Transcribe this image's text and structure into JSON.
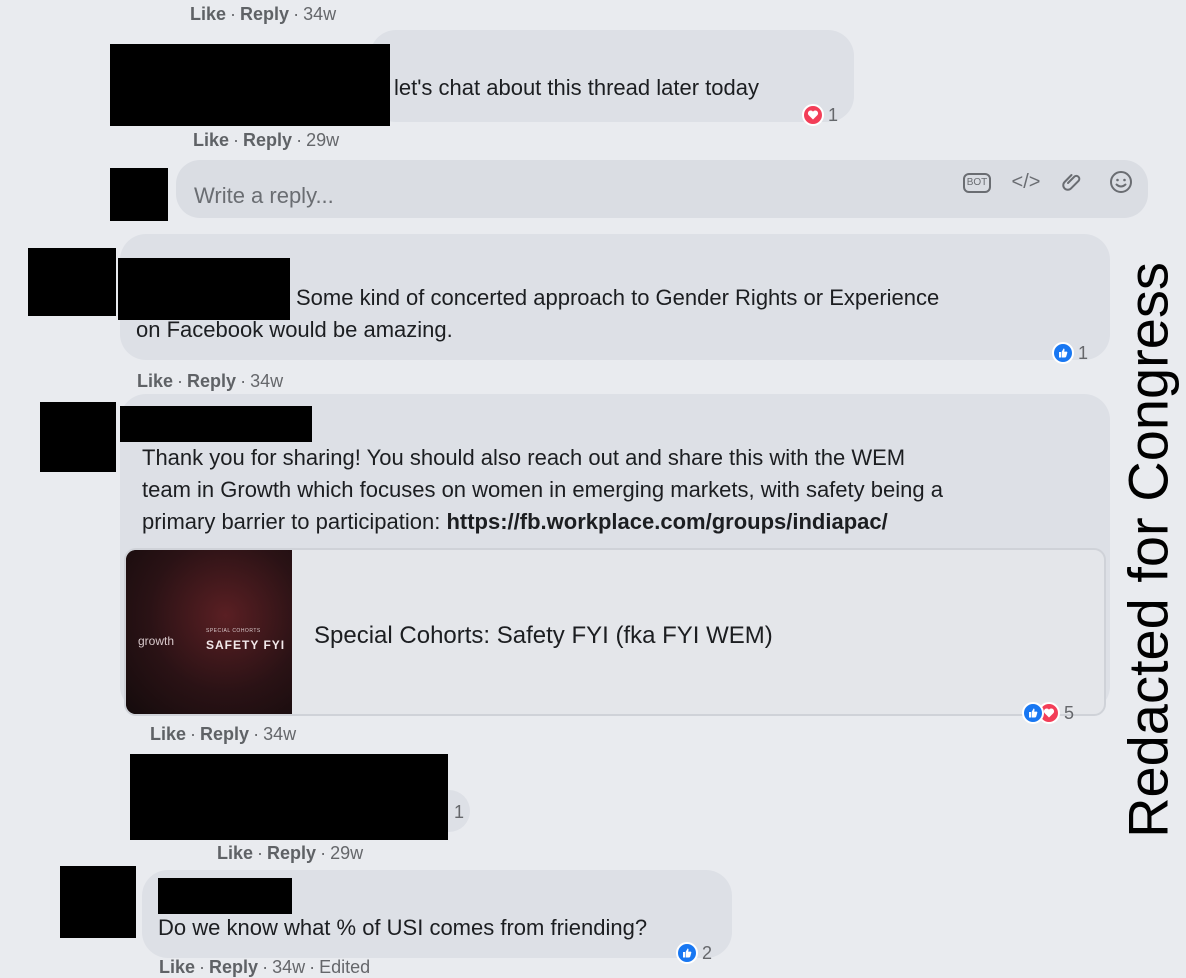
{
  "meta_like": "Like",
  "meta_reply": "Reply",
  "meta_sep": "·",
  "comments": [
    {
      "time": "34w"
    },
    {
      "text": "let's chat about this thread later today",
      "reaction_count": "1",
      "time": "29w"
    },
    {
      "text_line1": "Some kind of concerted approach to Gender Rights or Experience",
      "text_line2": "on Facebook would be amazing.",
      "reaction_count": "1",
      "time": "34w"
    },
    {
      "text_line1": "Thank you for sharing! You should also reach out and share this with the WEM",
      "text_line2": "team in Growth which focuses on women in emerging markets, with safety being a",
      "text_line3_prefix": "primary barrier to participation: ",
      "link": "https://fb.workplace.com/groups/indiapac/",
      "reaction_count": "5",
      "time": "34w"
    },
    {
      "reaction_count": "1",
      "time": "29w"
    },
    {
      "text": "Do we know what % of USI comes from friending?",
      "reaction_count": "2",
      "time": "34w",
      "edited": "Edited"
    }
  ],
  "reply_box": {
    "placeholder": "Write a reply...",
    "bot_label": "BOT",
    "code_label": "</>"
  },
  "link_preview": {
    "title": "Special Cohorts: Safety FYI (fka FYI WEM)",
    "thumb_brand": "growth",
    "thumb_small": "SPECIAL COHORTS",
    "thumb_big": "SAFETY FYI"
  },
  "watermark": "Redacted for Congress",
  "colors": {
    "like_blue": "#1877f2",
    "love_red": "#f33e58",
    "bubble": "#dde0e6",
    "background": "#e9ebef"
  }
}
